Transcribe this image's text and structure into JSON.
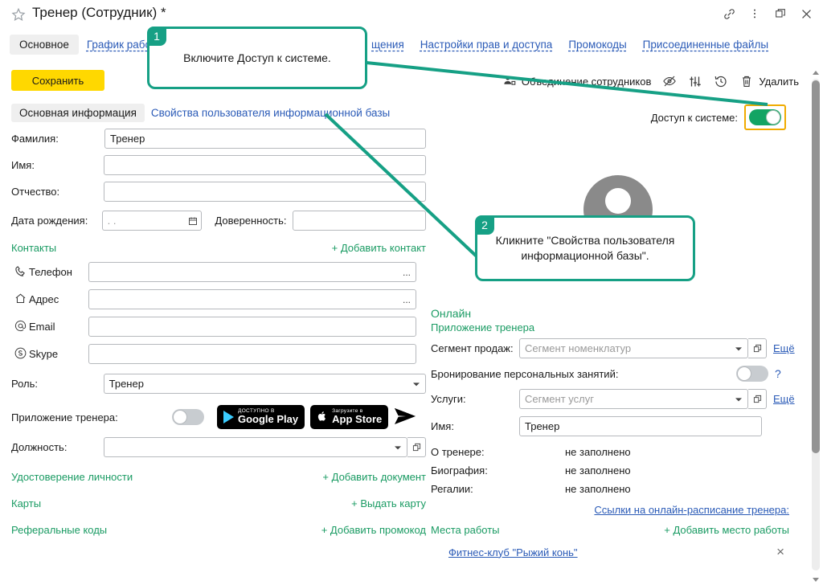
{
  "window": {
    "title": "Тренер (Сотрудник) *",
    "icons": {
      "favorite": "star-icon",
      "link": "link-icon",
      "menu": "more-vertical-icon",
      "restore": "restore-window-icon",
      "close": "close-icon"
    }
  },
  "top_tabs": [
    {
      "label": "Основное",
      "active": true
    },
    {
      "label": "График работы",
      "active": false
    },
    {
      "label": "щения",
      "active": false
    },
    {
      "label": "Настройки прав и доступа",
      "active": false
    },
    {
      "label": "Промокоды",
      "active": false
    },
    {
      "label": "Присоединенные файлы",
      "active": false
    }
  ],
  "toolbar": {
    "save_label": "Сохранить",
    "merge_label": "Объединение сотрудников",
    "delete_label": "Удалить",
    "icons": {
      "merge": "merge-users-icon",
      "hide": "eye-off-icon",
      "settings": "sliders-icon",
      "history": "history-icon",
      "delete": "trash-icon"
    }
  },
  "sub_tabs": [
    {
      "label": "Основная информация",
      "active": true
    },
    {
      "label": "Свойства пользователя информационной базы",
      "active": false
    }
  ],
  "access": {
    "label": "Доступ к системе:",
    "state": "on",
    "highlighted": true
  },
  "left_form": {
    "fields": [
      {
        "label": "Фамилия:",
        "value": "Тренер",
        "placeholder": ""
      },
      {
        "label": "Имя:",
        "value": "",
        "placeholder": ""
      },
      {
        "label": "Отчество:",
        "value": "",
        "placeholder": ""
      }
    ],
    "birth_label": "Дата рождения:",
    "birth_value": "  .  .",
    "proxy_label": "Доверенность:",
    "proxy_value": "",
    "contacts_title": "Контакты",
    "contacts_add": "+ Добавить контакт",
    "contacts": [
      {
        "icon": "phone-icon",
        "label": "Телефон",
        "value": "",
        "more": "..."
      },
      {
        "icon": "home-icon",
        "label": "Адрес",
        "value": "",
        "more": "..."
      },
      {
        "icon": "at-icon",
        "label": "Email",
        "value": "",
        "more": ""
      },
      {
        "icon": "skype-icon",
        "label": "Skype",
        "value": "",
        "more": ""
      }
    ],
    "role_label": "Роль:",
    "role_value": "Тренер",
    "trainer_app_label": "Приложение тренера:",
    "trainer_app_state": "off",
    "google_play": {
      "small": "ДОСТУПНО В",
      "big": "Google Play"
    },
    "app_store": {
      "small": "Загрузите в",
      "big": "App Store"
    },
    "position_label": "Должность:",
    "position_value": "",
    "sections": [
      {
        "title": "Удостоверение личности",
        "action": "+ Добавить документ"
      },
      {
        "title": "Карты",
        "action": "+ Выдать карту"
      },
      {
        "title": "Реферальные коды",
        "action": "+ Добавить промокод"
      }
    ]
  },
  "right_panel": {
    "online_title": "Онлайн",
    "app_subtitle": "Приложение тренера",
    "sales_segment_label": "Сегмент продаж:",
    "sales_segment_placeholder": "Сегмент номенклатур",
    "sales_segment_more": "Ещё",
    "booking_label": "Бронирование персональных занятий:",
    "booking_state": "off",
    "booking_help": "?",
    "services_label": "Услуги:",
    "services_placeholder": "Сегмент услуг",
    "services_more": "Ещё",
    "name_label": "Имя:",
    "name_value": "Тренер",
    "info_rows": [
      {
        "label": "О тренере:",
        "value": "не заполнено"
      },
      {
        "label": "Биография:",
        "value": "не заполнено"
      },
      {
        "label": "Регалии:",
        "value": "не заполнено"
      }
    ],
    "schedule_link": "Ссылки на онлайн-расписание тренера:",
    "workplaces_title": "Места работы",
    "workplaces_add": "+ Добавить место работы",
    "workplaces": [
      {
        "name": "Фитнес-клуб \"Рыжий конь\"",
        "remove": "×"
      }
    ]
  },
  "callouts": [
    {
      "number": "1",
      "text": "Включите Доступ к системе."
    },
    {
      "number": "2",
      "text": "Кликните \"Свойства пользователя информационной базы\"."
    }
  ],
  "colors": {
    "accent_green": "#16a085",
    "toggle_on": "#13a463",
    "save_yellow": "#ffd800",
    "link_blue": "#2b5bb7",
    "section_green": "#1a9b63",
    "highlight_orange": "#f0ab00"
  }
}
